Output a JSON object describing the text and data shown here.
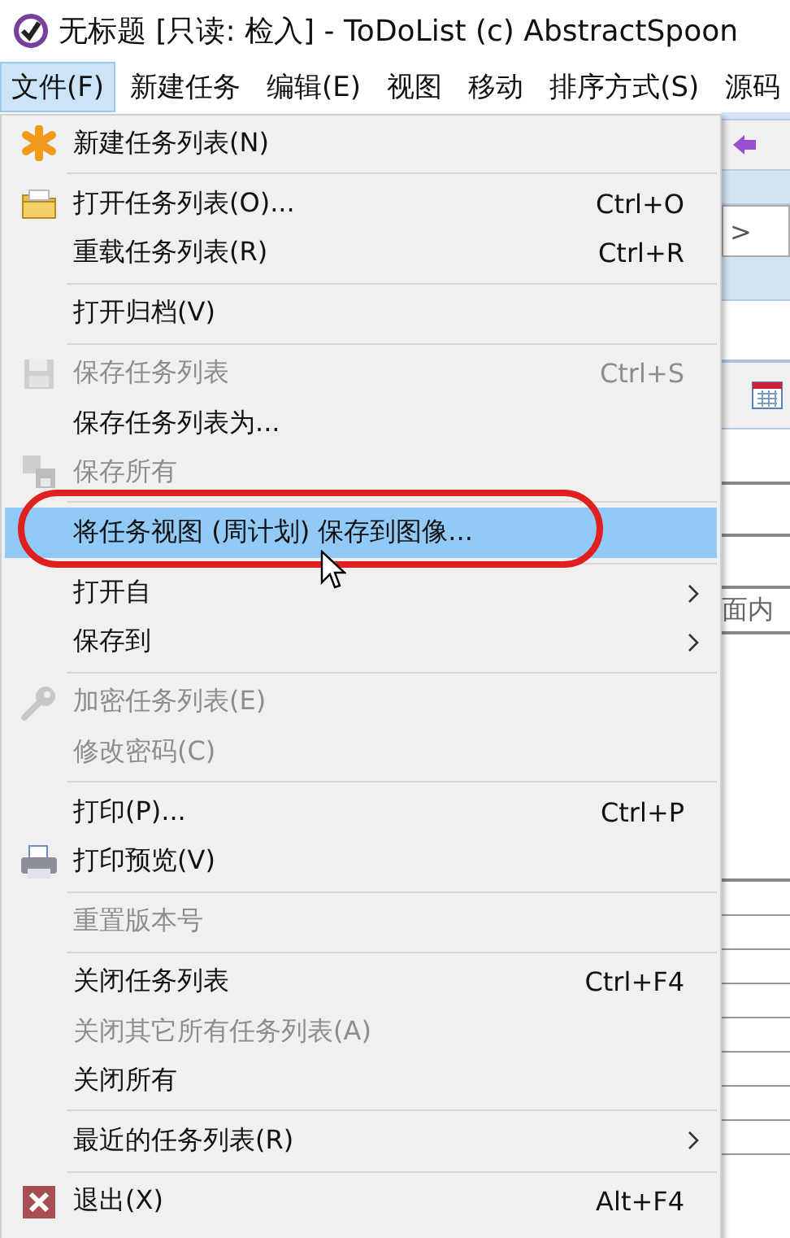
{
  "window": {
    "title": "无标题 [只读: 检入] - ToDoList (c) AbstractSpoon"
  },
  "menubar": [
    {
      "label": "文件(F)",
      "selected": true
    },
    {
      "label": "新建任务",
      "selected": false
    },
    {
      "label": "编辑(E)",
      "selected": false
    },
    {
      "label": "视图",
      "selected": false
    },
    {
      "label": "移动",
      "selected": false
    },
    {
      "label": "排序方式(S)",
      "selected": false
    },
    {
      "label": "源码",
      "selected": false
    }
  ],
  "background": {
    "texts": [
      ">",
      "面内"
    ]
  },
  "menu": [
    {
      "kind": "item",
      "label": "新建任务列表(N)",
      "disabled": false,
      "selected": false
    },
    {
      "kind": "separator"
    },
    {
      "kind": "item",
      "label": "打开任务列表(O)...",
      "shortcut": "Ctrl+O",
      "disabled": false,
      "selected": false
    },
    {
      "kind": "item",
      "label": "重载任务列表(R)",
      "shortcut": "Ctrl+R",
      "disabled": false,
      "selected": false
    },
    {
      "kind": "separator"
    },
    {
      "kind": "item",
      "label": "打开归档(V)",
      "disabled": false,
      "selected": false
    },
    {
      "kind": "separator"
    },
    {
      "kind": "item",
      "label": "保存任务列表",
      "shortcut": "Ctrl+S",
      "disabled": true,
      "selected": false
    },
    {
      "kind": "item",
      "label": "保存任务列表为...",
      "disabled": false,
      "selected": false
    },
    {
      "kind": "item",
      "label": "保存所有",
      "disabled": true,
      "selected": false
    },
    {
      "kind": "separator"
    },
    {
      "kind": "item",
      "label": "将任务视图 (周计划) 保存到图像...",
      "disabled": false,
      "selected": true
    },
    {
      "kind": "separator"
    },
    {
      "kind": "item",
      "label": "打开自",
      "submenu": true,
      "disabled": false,
      "selected": false
    },
    {
      "kind": "item",
      "label": "保存到",
      "submenu": true,
      "disabled": false,
      "selected": false
    },
    {
      "kind": "separator"
    },
    {
      "kind": "item",
      "label": "加密任务列表(E)",
      "disabled": true,
      "selected": false
    },
    {
      "kind": "item",
      "label": "修改密码(C)",
      "disabled": true,
      "selected": false
    },
    {
      "kind": "separator"
    },
    {
      "kind": "item",
      "label": "打印(P)...",
      "shortcut": "Ctrl+P",
      "disabled": false,
      "selected": false
    },
    {
      "kind": "item",
      "label": "打印预览(V)",
      "disabled": false,
      "selected": false
    },
    {
      "kind": "separator"
    },
    {
      "kind": "item",
      "label": "重置版本号",
      "disabled": true,
      "selected": false
    },
    {
      "kind": "separator"
    },
    {
      "kind": "item",
      "label": "关闭任务列表",
      "shortcut": "Ctrl+F4",
      "disabled": false,
      "selected": false
    },
    {
      "kind": "item",
      "label": "关闭其它所有任务列表(A)",
      "disabled": true,
      "selected": false
    },
    {
      "kind": "item",
      "label": "关闭所有",
      "disabled": false,
      "selected": false
    },
    {
      "kind": "separator"
    },
    {
      "kind": "item",
      "label": "最近的任务列表(R)",
      "submenu": true,
      "disabled": false,
      "selected": false
    },
    {
      "kind": "separator"
    },
    {
      "kind": "item",
      "label": "退出(X)",
      "shortcut": "Alt+F4",
      "disabled": false,
      "selected": false
    }
  ]
}
